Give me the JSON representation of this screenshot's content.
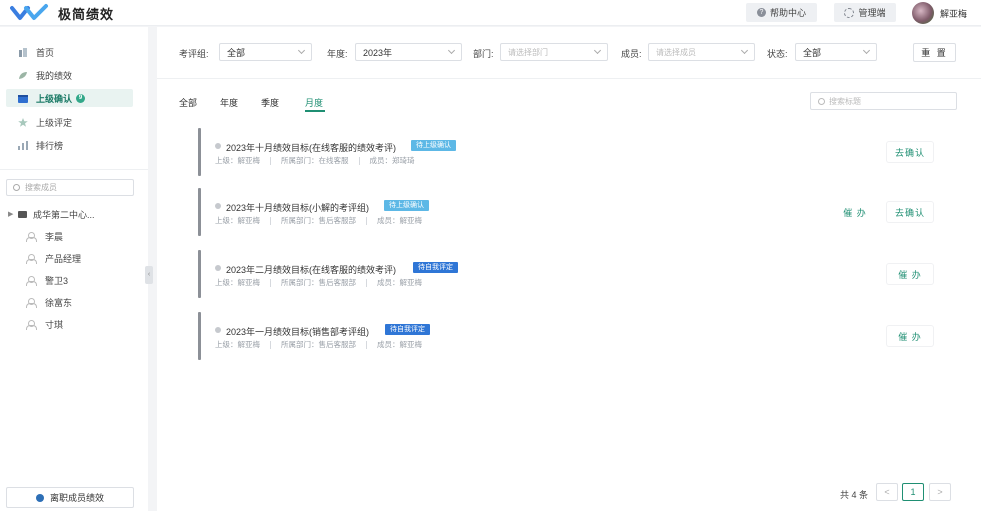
{
  "app": {
    "title": "极简绩效"
  },
  "header": {
    "help_label": "帮助中心",
    "admin_label": "管理端",
    "user_name": "解亚梅"
  },
  "sidebar": {
    "nav": [
      {
        "label": "首页",
        "icon": "home-icon"
      },
      {
        "label": "我的绩效",
        "icon": "leaf-icon"
      },
      {
        "label": "上级确认",
        "icon": "calendar-icon",
        "badge": "9",
        "active": true
      },
      {
        "label": "上级评定",
        "icon": "star-icon"
      },
      {
        "label": "排行榜",
        "icon": "bar-chart-icon"
      }
    ],
    "search_placeholder": "搜索成员",
    "tree": {
      "group": "成华第二中心...",
      "members": [
        "李晨",
        "产品经理",
        "警卫3",
        "徐富东",
        "寸琪"
      ]
    },
    "leave_button": "离职成员绩效"
  },
  "filters": {
    "group_label": "考评组:",
    "group_value": "全部",
    "year_label": "年度:",
    "year_value": "2023年",
    "dept_label": "部门:",
    "dept_placeholder": "请选择部门",
    "member_label": "成员:",
    "member_placeholder": "请选择成员",
    "status_label": "状态:",
    "status_value": "全部",
    "reset_label": "重 置"
  },
  "tabs": [
    "全部",
    "年度",
    "季度",
    "月度"
  ],
  "active_tab": "月度",
  "tab_search_placeholder": "搜索标题",
  "cards": [
    {
      "title": "2023年十月绩效目标(在线客服的绩效考评)",
      "tag": "待上级确认",
      "superior": "上级：解亚梅",
      "dept": "所属部门：在线客服",
      "member": "成员：郑琦琦",
      "actions": [
        "去确认"
      ]
    },
    {
      "title": "2023年十月绩效目标(小解的考评组)",
      "tag": "待上级确认",
      "superior": "上级：解亚梅",
      "dept": "所属部门：售后客服部",
      "member": "成员：解亚梅",
      "actions": [
        "催 办",
        "去确认"
      ]
    },
    {
      "title": "2023年二月绩效目标(在线客服的绩效考评)",
      "tag": "待自我评定",
      "superior": "上级：解亚梅",
      "dept": "所属部门：售后客服部",
      "member": "成员：解亚梅",
      "actions": [
        "催 办"
      ]
    },
    {
      "title": "2023年一月绩效目标(销售部考评组)",
      "tag": "待自我评定",
      "superior": "上级：解亚梅",
      "dept": "所属部门：售后客服部",
      "member": "成员：解亚梅",
      "actions": [
        "催 办"
      ]
    }
  ],
  "pagination": {
    "total_label": "共 4 条",
    "prev": "<",
    "current": "1",
    "next": ">"
  },
  "colors": {
    "accent": "#1f8f73",
    "tag_confirm": "#5db8e6",
    "tag_self": "#2f76d6"
  }
}
